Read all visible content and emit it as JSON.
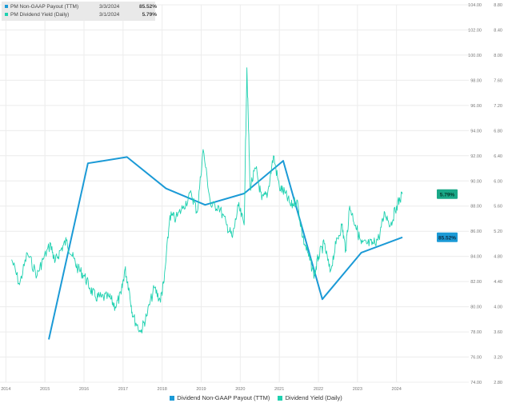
{
  "legend_box": {
    "rows": [
      {
        "name": "PM Non-GAAP Payout (TTM)",
        "date": "3/3/2024",
        "value": "85.52%",
        "color": "#1b9ad6"
      },
      {
        "name": "PM Dividend Yield (Daily)",
        "date": "3/1/2024",
        "value": "5.79%",
        "color": "#1fd1b0"
      }
    ]
  },
  "bottom_legend": [
    {
      "label": "Dividend Non-GAAP Payout (TTM)",
      "color": "#1b9ad6"
    },
    {
      "label": "Dividend Yield (Daily)",
      "color": "#1fd1b0"
    }
  ],
  "chart_data": {
    "type": "line",
    "x_ticks": [
      "2014",
      "2015",
      "2016",
      "2017",
      "2018",
      "2019",
      "2020",
      "2021",
      "2022",
      "2023",
      "2024"
    ],
    "left_axis": {
      "ticks": [
        "104.00",
        "102.00",
        "100.00",
        "98.00",
        "96.00",
        "94.00",
        "92.00",
        "90.00",
        "88.00",
        "86.00",
        "84.00",
        "82.00",
        "80.00",
        "78.00",
        "76.00",
        "74.00"
      ],
      "range": [
        74,
        104
      ]
    },
    "right_axis": {
      "ticks": [
        "8.80",
        "8.40",
        "8.00",
        "7.60",
        "7.20",
        "6.80",
        "6.40",
        "6.00",
        "5.60",
        "5.20",
        "4.80",
        "4.40",
        "4.00",
        "3.60",
        "3.20",
        "2.80"
      ],
      "range": [
        2.8,
        8.8
      ]
    },
    "x_range": [
      2013.9,
      2025.9
    ],
    "grid": true,
    "series": [
      {
        "name": "Dividend Non-GAAP Payout (TTM)",
        "axis": "left",
        "color": "#1b9ad6",
        "end_label": "85.52%",
        "x": [
          2015.15,
          2016.15,
          2017.15,
          2018.15,
          2019.15,
          2020.15,
          2021.15,
          2022.15,
          2023.15,
          2024.2
        ],
        "values": [
          77.4,
          91.4,
          91.9,
          89.4,
          88.1,
          89.0,
          91.6,
          80.6,
          84.3,
          85.52
        ]
      },
      {
        "name": "Dividend Yield (Daily)",
        "axis": "right",
        "color": "#1fd1b0",
        "end_label": "5.79%",
        "x": [
          2014.2,
          2014.4,
          2014.6,
          2014.85,
          2015.0,
          2015.2,
          2015.3,
          2015.45,
          2015.6,
          2015.75,
          2015.9,
          2016.05,
          2016.2,
          2016.35,
          2016.5,
          2016.7,
          2016.85,
          2017.0,
          2017.1,
          2017.2,
          2017.3,
          2017.5,
          2017.65,
          2017.85,
          2018.0,
          2018.1,
          2018.25,
          2018.4,
          2018.6,
          2018.8,
          2018.95,
          2019.1,
          2019.3,
          2019.5,
          2019.7,
          2019.85,
          2020.0,
          2020.15,
          2020.22,
          2020.3,
          2020.45,
          2020.6,
          2020.75,
          2020.9,
          2021.05,
          2021.2,
          2021.35,
          2021.5,
          2021.65,
          2021.8,
          2021.95,
          2022.05,
          2022.2,
          2022.35,
          2022.5,
          2022.65,
          2022.75,
          2022.85,
          2023.0,
          2023.15,
          2023.3,
          2023.45,
          2023.6,
          2023.75,
          2023.9,
          2024.05,
          2024.2
        ],
        "values": [
          4.75,
          4.35,
          4.85,
          4.5,
          4.75,
          5.0,
          4.7,
          4.9,
          5.05,
          4.8,
          4.6,
          4.5,
          4.3,
          4.15,
          4.15,
          4.15,
          4.0,
          4.2,
          4.6,
          4.3,
          3.85,
          3.6,
          3.85,
          4.3,
          4.1,
          4.4,
          5.45,
          5.4,
          5.6,
          5.8,
          5.5,
          6.5,
          5.6,
          5.6,
          5.3,
          5.1,
          5.6,
          5.3,
          7.8,
          5.9,
          6.2,
          5.7,
          5.8,
          6.4,
          5.9,
          5.8,
          5.6,
          5.7,
          5.1,
          4.8,
          4.5,
          4.8,
          5.0,
          4.55,
          5.0,
          5.3,
          4.9,
          5.6,
          5.3,
          5.0,
          5.0,
          5.0,
          5.1,
          5.5,
          5.3,
          5.6,
          5.79
        ]
      }
    ]
  }
}
